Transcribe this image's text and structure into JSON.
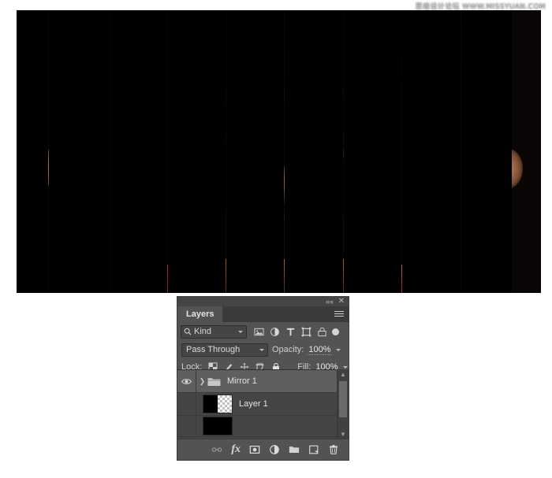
{
  "canvas": {
    "name": "photoshop-canvas",
    "description": "Portrait of a man sliced into vertical mirrored stripes over black background",
    "background_color": "#000000",
    "stripes": [
      {
        "left_pct": 0.0,
        "width_pct": 6.0
      },
      {
        "left_pct": 12.5,
        "width_pct": 5.2
      },
      {
        "left_pct": 23.5,
        "width_pct": 5.2
      },
      {
        "left_pct": 34.6,
        "width_pct": 5.2
      },
      {
        "left_pct": 45.8,
        "width_pct": 5.2
      },
      {
        "left_pct": 57.0,
        "width_pct": 5.2
      },
      {
        "left_pct": 68.2,
        "width_pct": 5.2
      },
      {
        "left_pct": 79.4,
        "width_pct": 5.2
      },
      {
        "left_pct": 90.5,
        "width_pct": 4.0
      }
    ]
  },
  "watermark": {
    "text": "思缘设计论坛 WWW.MISSYUAN.COM"
  },
  "layers_panel": {
    "title": "Layers",
    "topbar": {
      "collapse_label": "««",
      "close_label": "✕"
    },
    "menu_icon": "panel-menu-icon",
    "filter": {
      "kind_label": "Kind",
      "search_icon": "search-icon",
      "icons": [
        "filter-pixel-layers-icon",
        "filter-adjustment-layers-icon",
        "filter-type-layers-icon",
        "filter-shape-layers-icon",
        "filter-smart-object-icon"
      ],
      "toggle_icon": "filter-enable-toggle"
    },
    "blend": {
      "mode": "Pass Through",
      "opacity_label": "Opacity:",
      "opacity_value": "100%"
    },
    "lock": {
      "label": "Lock:",
      "icons": [
        "lock-transparent-pixels-icon",
        "lock-image-pixels-icon",
        "lock-position-icon",
        "lock-artboard-nesting-icon",
        "lock-all-icon"
      ],
      "fill_label": "Fill:",
      "fill_value": "100%"
    },
    "layers": [
      {
        "name": "Mirror 1",
        "type": "group",
        "visible": true,
        "selected": true,
        "expanded": false,
        "eye_icon": "eye-icon",
        "disclosure_icon": "chevron-right-icon",
        "folder_icon": "folder-icon"
      },
      {
        "name": "Layer 1",
        "type": "pixel",
        "visible": false,
        "selected": false,
        "thumbnail": "half-black-half-transparent"
      },
      {
        "name": "",
        "type": "pixel",
        "visible": false,
        "selected": false,
        "thumbnail": "black"
      }
    ],
    "scrollbar": {
      "up_arrow": "▲",
      "down_arrow": "▼"
    },
    "footer_icons": [
      "link-layers-icon",
      "add-layer-style-icon",
      "add-layer-mask-icon",
      "new-fill-adjustment-layer-icon",
      "new-group-icon",
      "new-layer-icon",
      "delete-layer-icon"
    ],
    "footer_fx_label": "fx"
  }
}
